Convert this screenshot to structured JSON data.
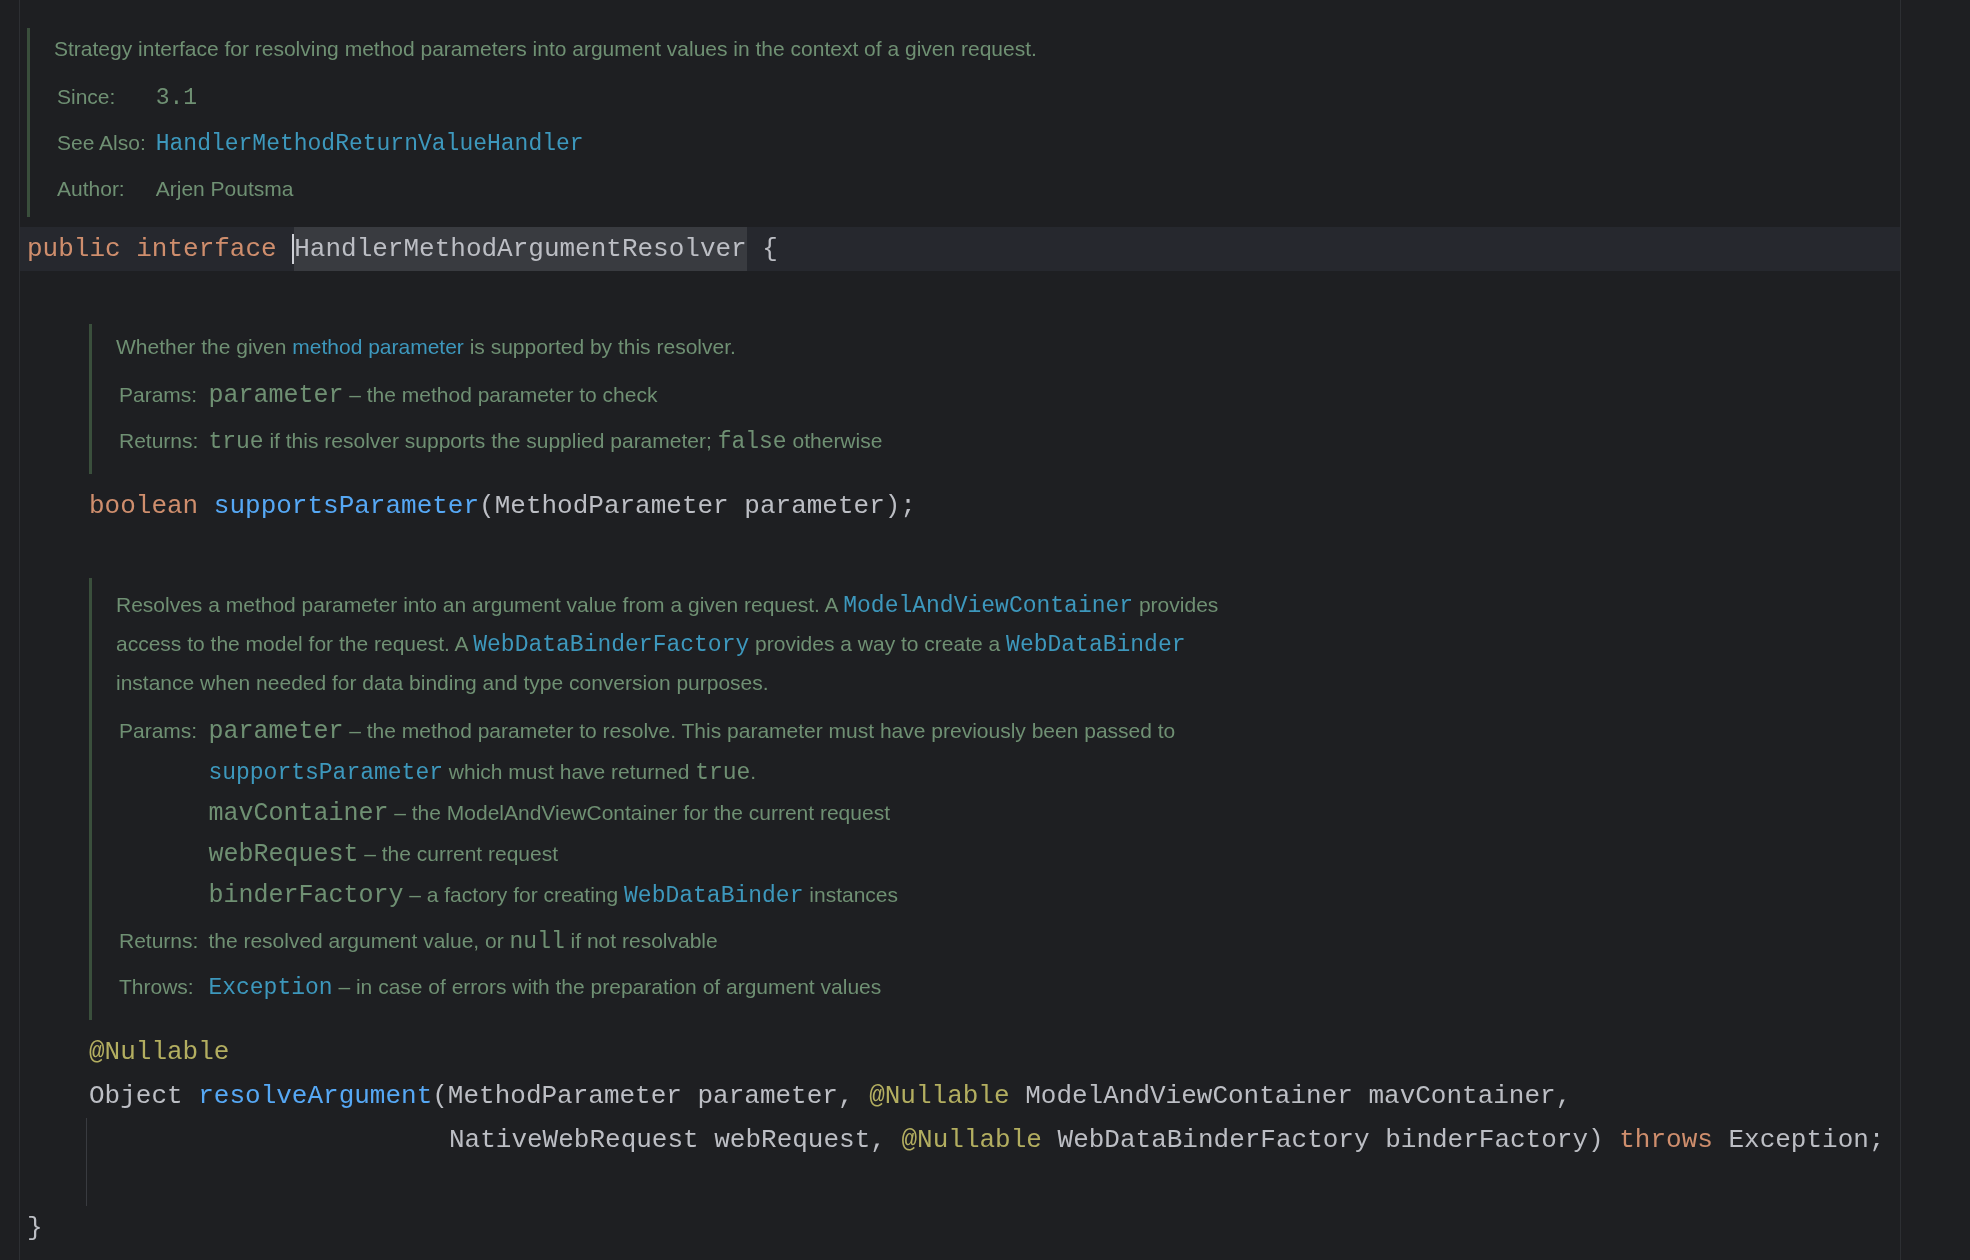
{
  "interface": {
    "doc": {
      "description": [
        [
          {
            "kind": "text",
            "text": "Strategy interface for resolving method parameters into argument values in the context of a given request."
          }
        ]
      ],
      "tags": [
        {
          "label": "Since:",
          "lines": [
            [
              {
                "kind": "code",
                "text": "3.1"
              }
            ]
          ]
        },
        {
          "label": "See Also:",
          "lines": [
            [
              {
                "kind": "code-link",
                "text": "HandlerMethodReturnValueHandler"
              }
            ]
          ]
        },
        {
          "label": "Author:",
          "lines": [
            [
              {
                "kind": "text",
                "text": "Arjen Poutsma"
              }
            ]
          ]
        }
      ]
    },
    "declaration": {
      "current": true,
      "tokens": [
        {
          "kind": "keyword",
          "text": "public interface ",
          "highlighted": false,
          "caret": false
        },
        {
          "kind": "plain",
          "text": "HandlerMethodArgumentResolver",
          "highlighted": true,
          "caret": true
        },
        {
          "kind": "plain",
          "text": " {",
          "highlighted": false,
          "caret": false
        }
      ]
    },
    "members": [
      {
        "doc": {
          "description": [
            [
              {
                "kind": "text",
                "text": "Whether the given "
              },
              {
                "kind": "link",
                "text": "method parameter"
              },
              {
                "kind": "text",
                "text": " is supported by this resolver."
              }
            ]
          ],
          "tags": [
            {
              "label": "Params:",
              "lines": [
                [
                  {
                    "kind": "param",
                    "text": "parameter"
                  },
                  {
                    "kind": "text",
                    "text": " – the method parameter to check"
                  }
                ]
              ]
            },
            {
              "label": "Returns:",
              "lines": [
                [
                  {
                    "kind": "code",
                    "text": "true"
                  },
                  {
                    "kind": "text",
                    "text": " if this resolver supports the supplied parameter; "
                  },
                  {
                    "kind": "code",
                    "text": "false"
                  },
                  {
                    "kind": "text",
                    "text": " otherwise"
                  }
                ]
              ]
            }
          ]
        },
        "lines": [
          {
            "continuation": false,
            "tokens": [
              {
                "kind": "keyword",
                "text": "boolean "
              },
              {
                "kind": "method",
                "text": "supportsParameter"
              },
              {
                "kind": "plain",
                "text": "(MethodParameter parameter);"
              }
            ]
          }
        ]
      },
      {
        "doc": {
          "description": [
            [
              {
                "kind": "text",
                "text": "Resolves a method parameter into an argument value from a given request. A "
              },
              {
                "kind": "code-link",
                "text": "ModelAndViewContainer"
              },
              {
                "kind": "text",
                "text": " provides"
              }
            ],
            [
              {
                "kind": "text",
                "text": "access to the model for the request. A "
              },
              {
                "kind": "code-link",
                "text": "WebDataBinderFactory"
              },
              {
                "kind": "text",
                "text": " provides a way to create a "
              },
              {
                "kind": "code-link",
                "text": "WebDataBinder"
              }
            ],
            [
              {
                "kind": "text",
                "text": "instance when needed for data binding and type conversion purposes."
              }
            ]
          ],
          "tags": [
            {
              "label": "Params:",
              "lines": [
                [
                  {
                    "kind": "param",
                    "text": "parameter"
                  },
                  {
                    "kind": "text",
                    "text": " – the method parameter to resolve. This parameter must have previously been passed to"
                  }
                ],
                [
                  {
                    "kind": "code-link",
                    "text": "supportsParameter"
                  },
                  {
                    "kind": "text",
                    "text": " which must have returned "
                  },
                  {
                    "kind": "code",
                    "text": "true"
                  },
                  {
                    "kind": "text",
                    "text": "."
                  }
                ],
                [
                  {
                    "kind": "param",
                    "text": "mavContainer"
                  },
                  {
                    "kind": "text",
                    "text": " – the ModelAndViewContainer for the current request"
                  }
                ],
                [
                  {
                    "kind": "param",
                    "text": "webRequest"
                  },
                  {
                    "kind": "text",
                    "text": " – the current request"
                  }
                ],
                [
                  {
                    "kind": "param",
                    "text": "binderFactory"
                  },
                  {
                    "kind": "text",
                    "text": " – a factory for creating "
                  },
                  {
                    "kind": "code-link",
                    "text": "WebDataBinder"
                  },
                  {
                    "kind": "text",
                    "text": " instances"
                  }
                ]
              ]
            },
            {
              "label": "Returns:",
              "lines": [
                [
                  {
                    "kind": "text",
                    "text": "the resolved argument value, or "
                  },
                  {
                    "kind": "code",
                    "text": "null"
                  },
                  {
                    "kind": "text",
                    "text": " if not resolvable"
                  }
                ]
              ]
            },
            {
              "label": "Throws:",
              "lines": [
                [
                  {
                    "kind": "code-link",
                    "text": "Exception"
                  },
                  {
                    "kind": "text",
                    "text": " – in case of errors with the preparation of argument values"
                  }
                ]
              ]
            }
          ]
        },
        "lines": [
          {
            "continuation": false,
            "tokens": [
              {
                "kind": "annotation",
                "text": "@Nullable"
              }
            ]
          },
          {
            "continuation": false,
            "tokens": [
              {
                "kind": "plain",
                "text": "Object "
              },
              {
                "kind": "method",
                "text": "resolveArgument"
              },
              {
                "kind": "plain",
                "text": "(MethodParameter parameter, "
              },
              {
                "kind": "annotation",
                "text": "@Nullable"
              },
              {
                "kind": "plain",
                "text": " ModelAndViewContainer mavContainer,"
              }
            ]
          },
          {
            "continuation": true,
            "tokens": [
              {
                "kind": "plain",
                "text": "NativeWebRequest webRequest, "
              },
              {
                "kind": "annotation",
                "text": "@Nullable"
              },
              {
                "kind": "plain",
                "text": " WebDataBinderFactory binderFactory) "
              },
              {
                "kind": "keyword",
                "text": "throws"
              },
              {
                "kind": "plain",
                "text": " Exception;"
              }
            ]
          }
        ]
      }
    ],
    "closing": {
      "tokens": [
        {
          "kind": "plain",
          "text": "}"
        }
      ]
    }
  }
}
